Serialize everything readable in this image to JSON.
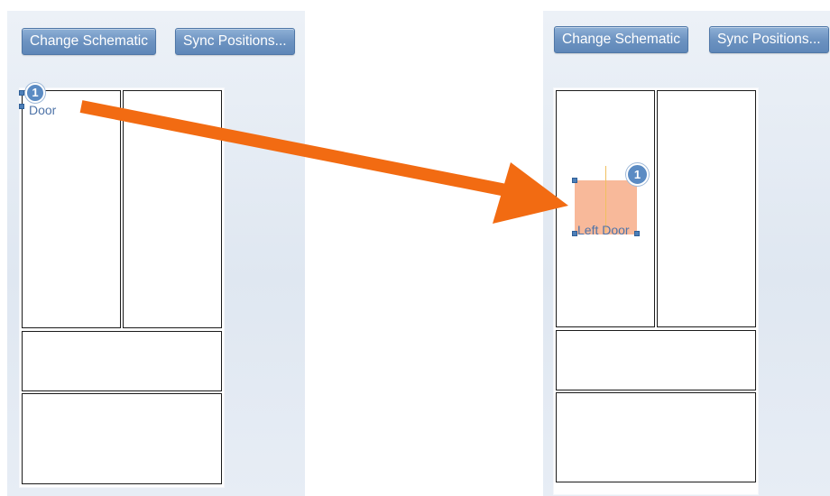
{
  "toolbar": {
    "change_schematic_label": "Change Schematic",
    "sync_positions_label": "Sync Positions..."
  },
  "before": {
    "component_badge": "1",
    "component_label": "Door"
  },
  "after": {
    "component_badge": "1",
    "component_label": "Left Door"
  },
  "colors": {
    "arrow": "#f26b12",
    "selection_fill": "#f8b99a",
    "button": "#6d93c1",
    "badge": "#5b8bc3",
    "panel": "#e3eaf3"
  },
  "icons": {
    "transition_arrow": "arrow-right-icon"
  }
}
